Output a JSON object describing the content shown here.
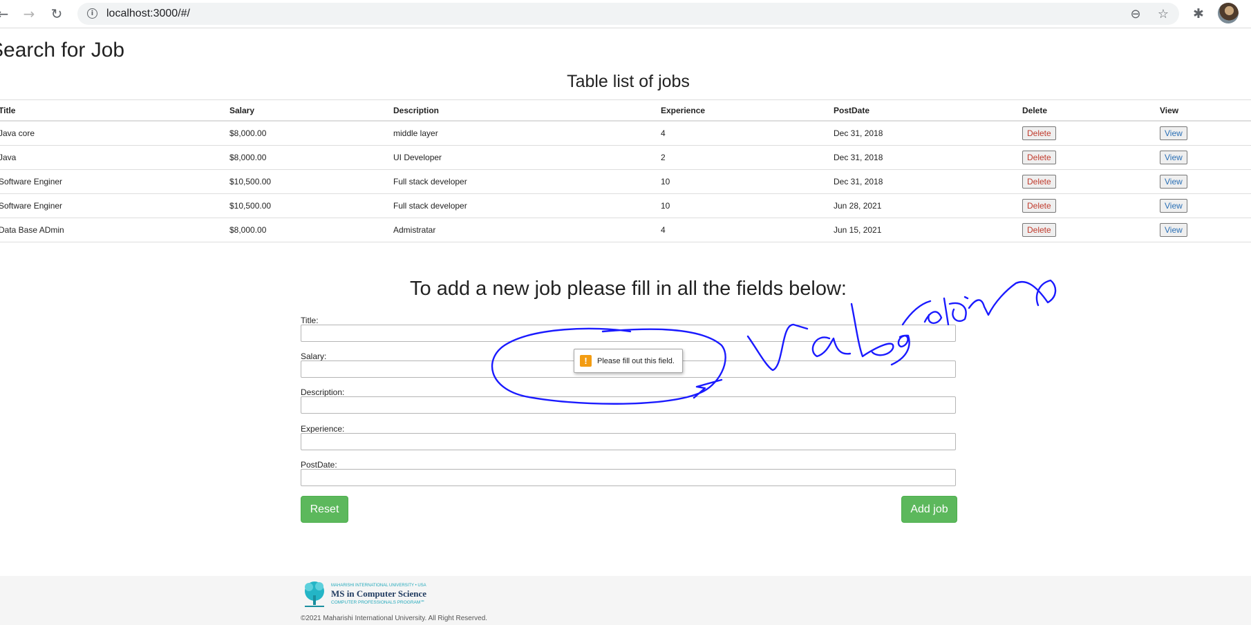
{
  "browser": {
    "url": "localhost:3000/#/",
    "back_icon": "arrow-left-icon",
    "forward_icon": "arrow-right-icon",
    "reload_icon": "reload-icon",
    "info_icon": "info-icon",
    "zoom_icon": "zoom-out-icon",
    "star_icon": "star-icon",
    "extensions_icon": "puzzle-icon"
  },
  "page": {
    "heading": "Search for Job",
    "table_title": "Table list of jobs"
  },
  "table": {
    "headers": [
      "Title",
      "Salary",
      "Description",
      "Experience",
      "PostDate",
      "Delete",
      "View"
    ],
    "rows": [
      {
        "title": "Java core",
        "salary": "$8,000.00",
        "description": "middle layer",
        "experience": "4",
        "postdate": "Dec 31, 2018",
        "delete": "Delete",
        "view": "View"
      },
      {
        "title": "Java",
        "salary": "$8,000.00",
        "description": "UI Developer",
        "experience": "2",
        "postdate": "Dec 31, 2018",
        "delete": "Delete",
        "view": "View"
      },
      {
        "title": "Software Enginer",
        "salary": "$10,500.00",
        "description": "Full stack developer",
        "experience": "10",
        "postdate": "Dec 31, 2018",
        "delete": "Delete",
        "view": "View"
      },
      {
        "title": "Software Enginer",
        "salary": "$10,500.00",
        "description": "Full stack developer",
        "experience": "10",
        "postdate": "Jun 28, 2021",
        "delete": "Delete",
        "view": "View"
      },
      {
        "title": "Data Base ADmin",
        "salary": "$8,000.00",
        "description": "Admistratar",
        "experience": "4",
        "postdate": "Jun 15, 2021",
        "delete": "Delete",
        "view": "View"
      }
    ]
  },
  "form": {
    "heading": "To add a new job please fill in all the fields below:",
    "fields": {
      "title": {
        "label": "Title:",
        "value": ""
      },
      "salary": {
        "label": "Salary:",
        "value": ""
      },
      "description": {
        "label": "Description:",
        "value": ""
      },
      "experience": {
        "label": "Experience:",
        "value": ""
      },
      "postdate": {
        "label": "PostDate:",
        "value": ""
      }
    },
    "reset_label": "Reset",
    "add_label": "Add job",
    "validation_message": "Please fill out this field.",
    "button_color": "#5cb85c"
  },
  "annotation": {
    "handwritten_text": "validation",
    "color": "#1a1aff"
  },
  "footer": {
    "logo": {
      "university": "MAHARISHI INTERNATIONAL UNIVERSITY • USA",
      "program": "MS in Computer Science",
      "tagline": "COMPUTER PROFESSIONALS PROGRAM℠"
    },
    "copyright": "©2021 Maharishi International University. All Right Reserved."
  }
}
